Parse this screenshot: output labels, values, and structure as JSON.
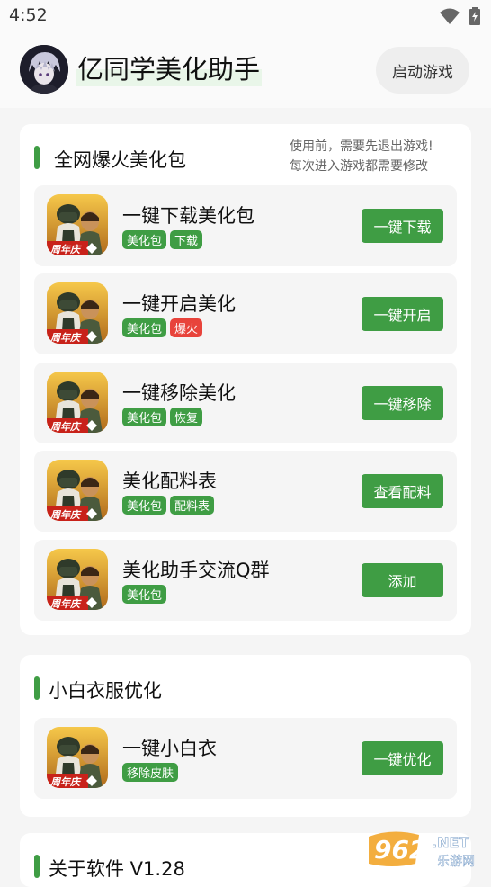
{
  "status_bar": {
    "time": "4:52"
  },
  "header": {
    "title": "亿同学美化助手",
    "launch_label": "启动游戏"
  },
  "section1": {
    "title": "全网爆火美化包",
    "note_line1": "使用前，需要先退出游戏!",
    "note_line2": "每次进入游戏都需要修改",
    "items": [
      {
        "title": "一键下载美化包",
        "tags": [
          "美化包",
          "下载"
        ],
        "button": "一键下载"
      },
      {
        "title": "一键开启美化",
        "tags": [
          "美化包",
          "爆火"
        ],
        "button": "一键开启"
      },
      {
        "title": "一键移除美化",
        "tags": [
          "美化包",
          "恢复"
        ],
        "button": "一键移除"
      },
      {
        "title": "美化配料表",
        "tags": [
          "美化包",
          "配料表"
        ],
        "button": "查看配料"
      },
      {
        "title": "美化助手交流Q群",
        "tags": [
          "美化包"
        ],
        "button": "添加"
      }
    ]
  },
  "section2": {
    "title": "小白衣服优化",
    "items": [
      {
        "title": "一键小白衣",
        "tags": [
          "移除皮肤"
        ],
        "button": "一键优化"
      }
    ]
  },
  "section3": {
    "title": "关于软件 V1.28"
  },
  "game_icon_caption": "周年庆",
  "watermark": {
    "number": "962",
    "suffix": ".NET",
    "sub": "乐游网"
  },
  "colors": {
    "accent": "#3f9d44",
    "tag_red": "#e8433b"
  }
}
